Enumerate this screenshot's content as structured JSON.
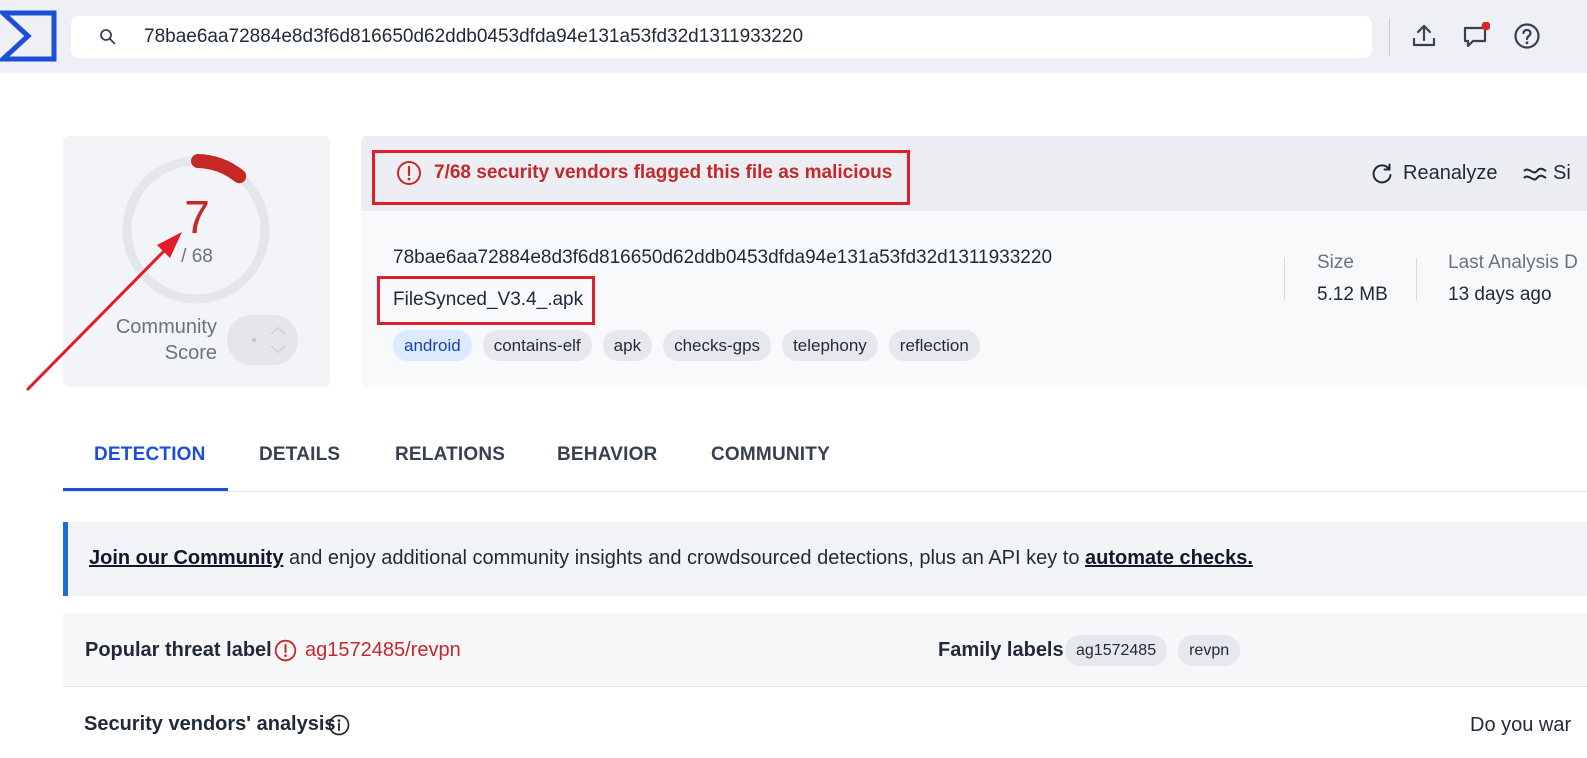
{
  "search": {
    "query": "78bae6aa72884e8d3f6d816650d62ddb0453dfda94e131a53fd32d1311933220"
  },
  "score": {
    "detections": "7",
    "total": "/ 68",
    "community_label_line1": "Community",
    "community_label_line2": "Score",
    "fraction": 0.103
  },
  "summary": {
    "malicious_text": "7/68 security vendors flagged this file as malicious",
    "reanalyze_label": "Reanalyze",
    "similar_label": "Si"
  },
  "file": {
    "hash": "78bae6aa72884e8d3f6d816650d62ddb0453dfda94e131a53fd32d1311933220",
    "name": "FileSynced_V3.4_.apk",
    "tags": [
      "android",
      "contains-elf",
      "apk",
      "checks-gps",
      "telephony",
      "reflection"
    ],
    "size_label": "Size",
    "size_value": "5.12 MB",
    "last_analysis_label": "Last Analysis D",
    "last_analysis_value": "13 days ago"
  },
  "tabs": [
    "DETECTION",
    "DETAILS",
    "RELATIONS",
    "BEHAVIOR",
    "COMMUNITY"
  ],
  "banner": {
    "link1": "Join our Community",
    "middle": " and enjoy additional community insights and crowdsourced detections, plus an API key to ",
    "link2": "automate checks."
  },
  "threat": {
    "popular_label": "Popular threat label",
    "popular_value": "ag1572485/revpn",
    "family_label": "Family labels",
    "family_tags": [
      "ag1572485",
      "revpn"
    ]
  },
  "vendors": {
    "title": "Security vendors' analysis",
    "right_text": "Do you war"
  },
  "colors": {
    "accent_blue": "#1d4ed8",
    "malicious_red": "#c62828",
    "annotation_red": "#e11d2a"
  }
}
